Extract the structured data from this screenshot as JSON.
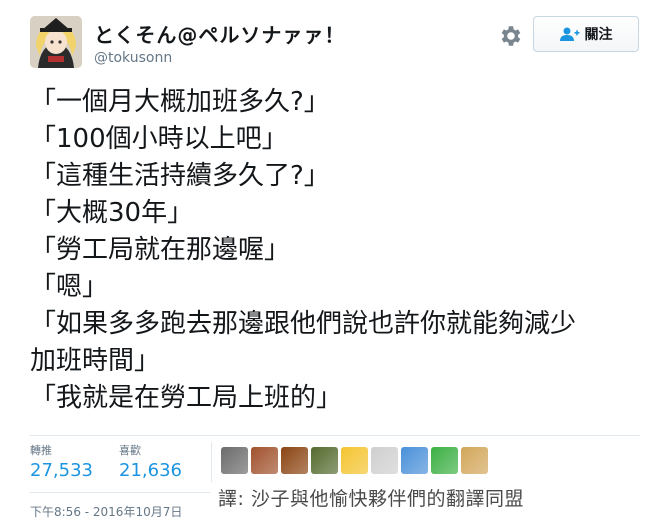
{
  "author": {
    "display_name": "とくそん@ペルソナァァ！",
    "handle": "@tokusonn"
  },
  "follow_button": {
    "label": "關注",
    "icon": "follow-user-icon"
  },
  "settings_icon": "gear-icon",
  "tweet_lines": [
    "「一個月大概加班多久?」",
    "「100個小時以上吧」",
    "「這種生活持續多久了?」",
    "「大概30年」",
    "「勞工局就在那邊喔」",
    "「嗯」",
    "「如果多多跑去那邊跟他們說也許你就能夠減少",
    "加班時間」",
    "「我就是在勞工局上班的」"
  ],
  "stats": {
    "retweets_label": "轉推",
    "retweets_value": "27,533",
    "likes_label": "喜歡",
    "likes_value": "21,636"
  },
  "liker_avatars": [
    {
      "name": "liker-avatar-1",
      "color": "#6b6b6b"
    },
    {
      "name": "liker-avatar-2",
      "color": "#a0522d"
    },
    {
      "name": "liker-avatar-3",
      "color": "#8b4513"
    },
    {
      "name": "liker-avatar-4",
      "color": "#556b2f"
    },
    {
      "name": "liker-avatar-5",
      "color": "#f4c430"
    },
    {
      "name": "liker-avatar-6",
      "color": "#cfcfcf"
    },
    {
      "name": "liker-avatar-7",
      "color": "#4a90d9"
    },
    {
      "name": "liker-avatar-8",
      "color": "#3cb043"
    },
    {
      "name": "liker-avatar-9",
      "color": "#d2a65a"
    }
  ],
  "timestamp": "下午8:56 - 2016年10月7日",
  "translation_caption": "譯: 沙子與他愉快夥伴們的翻譯同盟",
  "colors": {
    "link_blue": "#1b95e0",
    "muted_gray": "#657786",
    "text_dark": "#14171a",
    "divider": "#e1e8ed"
  }
}
